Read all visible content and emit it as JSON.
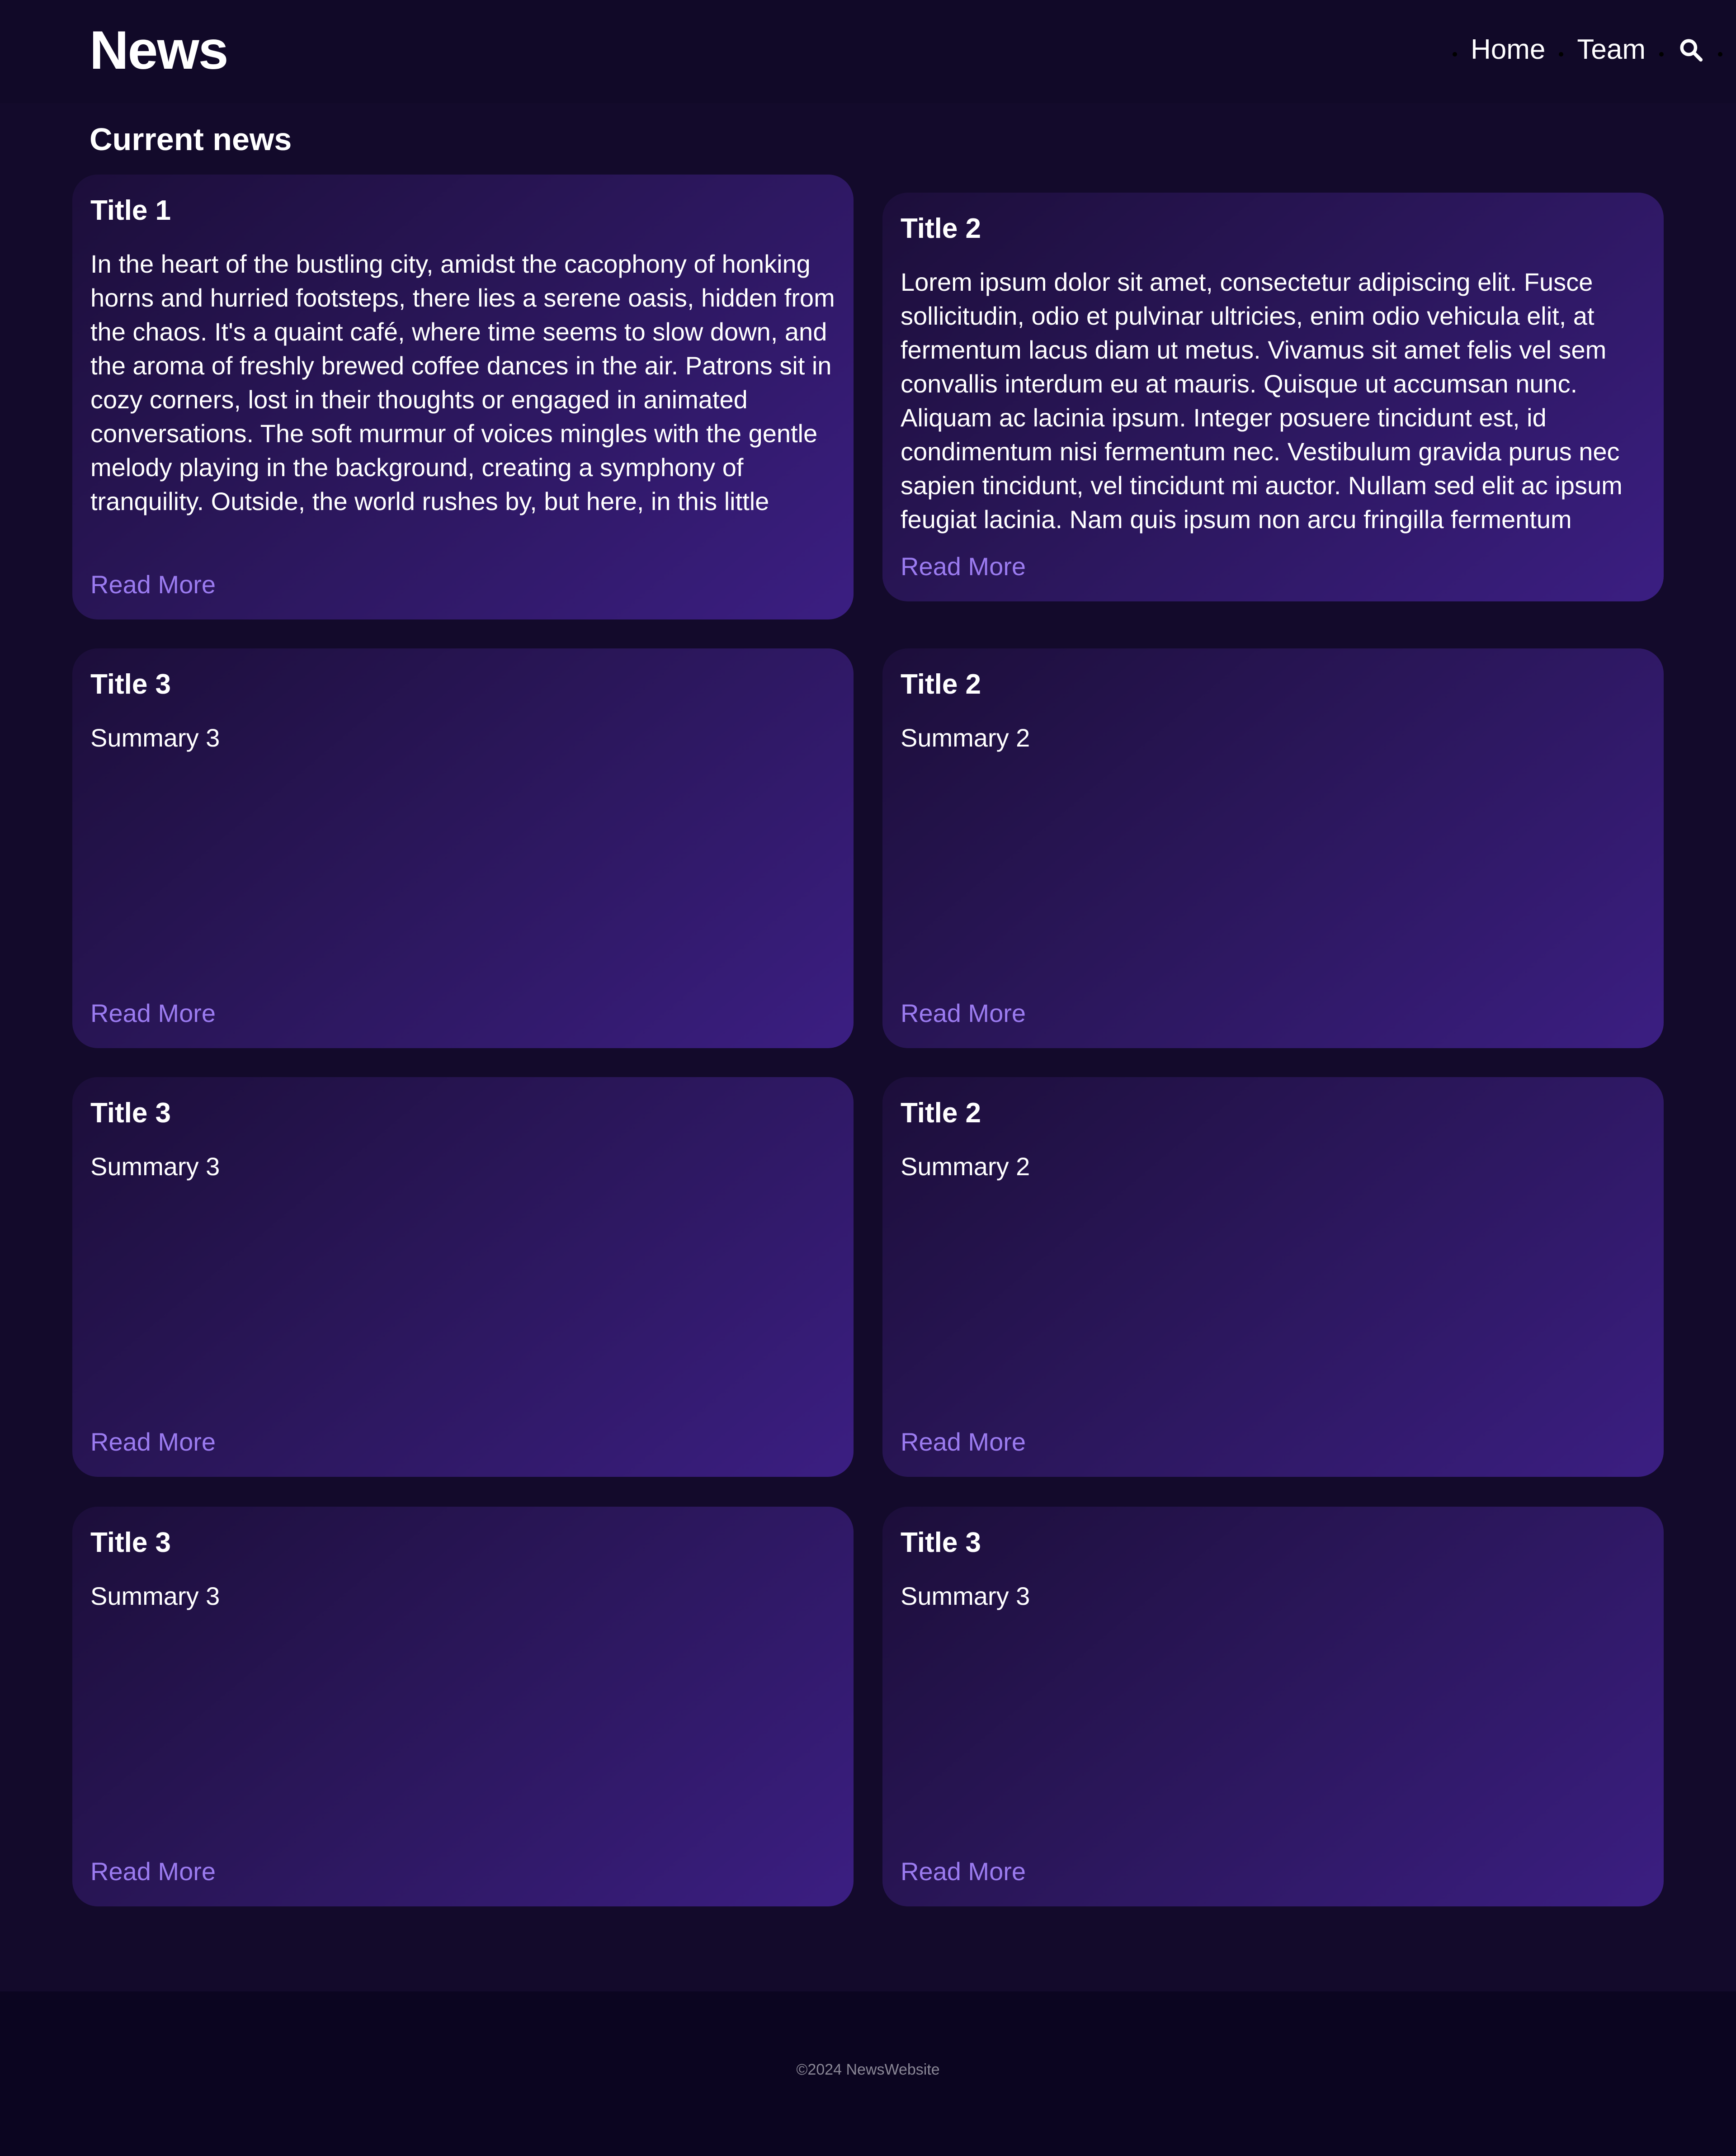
{
  "header": {
    "logo": "News",
    "nav": {
      "home_label": "Home",
      "team_label": "Team",
      "search_icon": "search-icon"
    }
  },
  "main": {
    "section_title": "Current news",
    "cards": [
      {
        "title": "Title 1",
        "summary": "In the heart of the bustling city, amidst the cacophony of honking horns and hurried footsteps, there lies a serene oasis, hidden from the chaos. It's a quaint café, where time seems to slow down, and the aroma of freshly brewed coffee dances in the air. Patrons sit in cozy corners, lost in their thoughts or engaged in animated conversations. The soft murmur of voices mingles with the gentle melody playing in the background, creating a symphony of tranquility. Outside, the world rushes by, but here, in this little haven, there's only peace and warmth.",
        "link": "Read More"
      },
      {
        "title": "Title 2",
        "summary": "Lorem ipsum dolor sit amet, consectetur adipiscing elit. Fusce sollicitudin, odio et pulvinar ultricies, enim odio vehicula elit, at fermentum lacus diam ut metus. Vivamus sit amet felis vel sem convallis interdum eu at mauris. Quisque ut accumsan nunc. Aliquam ac lacinia ipsum. Integer posuere tincidunt est, id condimentum nisi fermentum nec. Vestibulum gravida purus nec sapien tincidunt, vel tincidunt mi auctor. Nullam sed elit ac ipsum feugiat lacinia. Nam quis ipsum non arcu fringilla fermentum",
        "link": "Read More"
      },
      {
        "title": "Title 3",
        "summary": "Summary 3",
        "link": "Read More"
      },
      {
        "title": "Title 2",
        "summary": "Summary 2",
        "link": "Read More"
      },
      {
        "title": "Title 3",
        "summary": "Summary 3",
        "link": "Read More"
      },
      {
        "title": "Title 2",
        "summary": "Summary 2",
        "link": "Read More"
      },
      {
        "title": "Title 3",
        "summary": "Summary 3",
        "link": "Read More"
      },
      {
        "title": "Title 3",
        "summary": "Summary 3",
        "link": "Read More"
      }
    ]
  },
  "footer": {
    "copyright": "©2024 NewsWebsite"
  },
  "colors": {
    "page_background": "#130a2b",
    "card_gradient_start": "#1c0e3a",
    "card_gradient_end": "#3b1e82",
    "link": "#9b7bf0",
    "footer_background": "#0b0520",
    "footer_text": "#8a8796"
  }
}
